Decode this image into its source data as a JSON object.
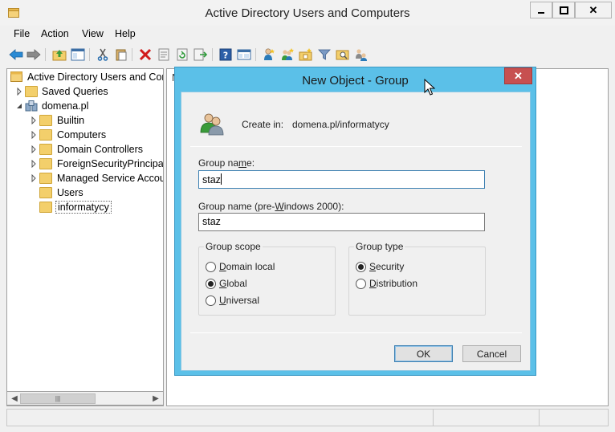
{
  "window": {
    "title": "Active Directory Users and Computers",
    "min_glyph": "▬",
    "max_glyph": "☐",
    "close_glyph": "✕"
  },
  "menu": [
    "File",
    "Action",
    "View",
    "Help"
  ],
  "toolbar_icons": [
    "back-arrow-icon",
    "forward-arrow-icon",
    "up-folder-icon",
    "show-hide-console-tree-icon",
    "cut-icon",
    "paste-icon",
    "delete-icon",
    "properties-icon",
    "refresh-icon",
    "export-list-icon",
    "help-icon",
    "console-view-icon",
    "new-user-icon",
    "new-group-icon",
    "new-ou-icon",
    "filter-icon",
    "find-icon",
    "add-to-group-icon"
  ],
  "tree": {
    "root": "Active Directory Users and Com",
    "saved_queries": "Saved Queries",
    "domain": "domena.pl",
    "children": [
      "Builtin",
      "Computers",
      "Domain Controllers",
      "ForeignSecurityPrincipals",
      "Managed Service Accour",
      "Users",
      "informatycy"
    ],
    "selected": "informatycy"
  },
  "right_pane": {
    "header_fragment": "N"
  },
  "dialog": {
    "title": "New Object - Group",
    "create_in_label": "Create in:",
    "create_in_path": "domena.pl/informatycy",
    "group_name_label_pre": "Group na",
    "group_name_label_mnemonic": "m",
    "group_name_label_post": "e:",
    "group_name_value": "staz",
    "pre2000_label_pre": "Group name (pre-",
    "pre2000_label_mnemonic": "W",
    "pre2000_label_post": "indows 2000):",
    "pre2000_value": "staz",
    "scope": {
      "title": "Group scope",
      "options": [
        {
          "mnemonic": "D",
          "rest": "omain local",
          "selected": false
        },
        {
          "mnemonic": "G",
          "rest": "lobal",
          "selected": true
        },
        {
          "mnemonic": "U",
          "rest": "niversal",
          "selected": false
        }
      ]
    },
    "type": {
      "title": "Group type",
      "options": [
        {
          "mnemonic": "S",
          "rest": "ecurity",
          "selected": true
        },
        {
          "mnemonic": "D",
          "rest": "istribution",
          "selected": false
        }
      ]
    },
    "ok_label": "OK",
    "cancel_label": "Cancel",
    "close_glyph": "✕"
  }
}
